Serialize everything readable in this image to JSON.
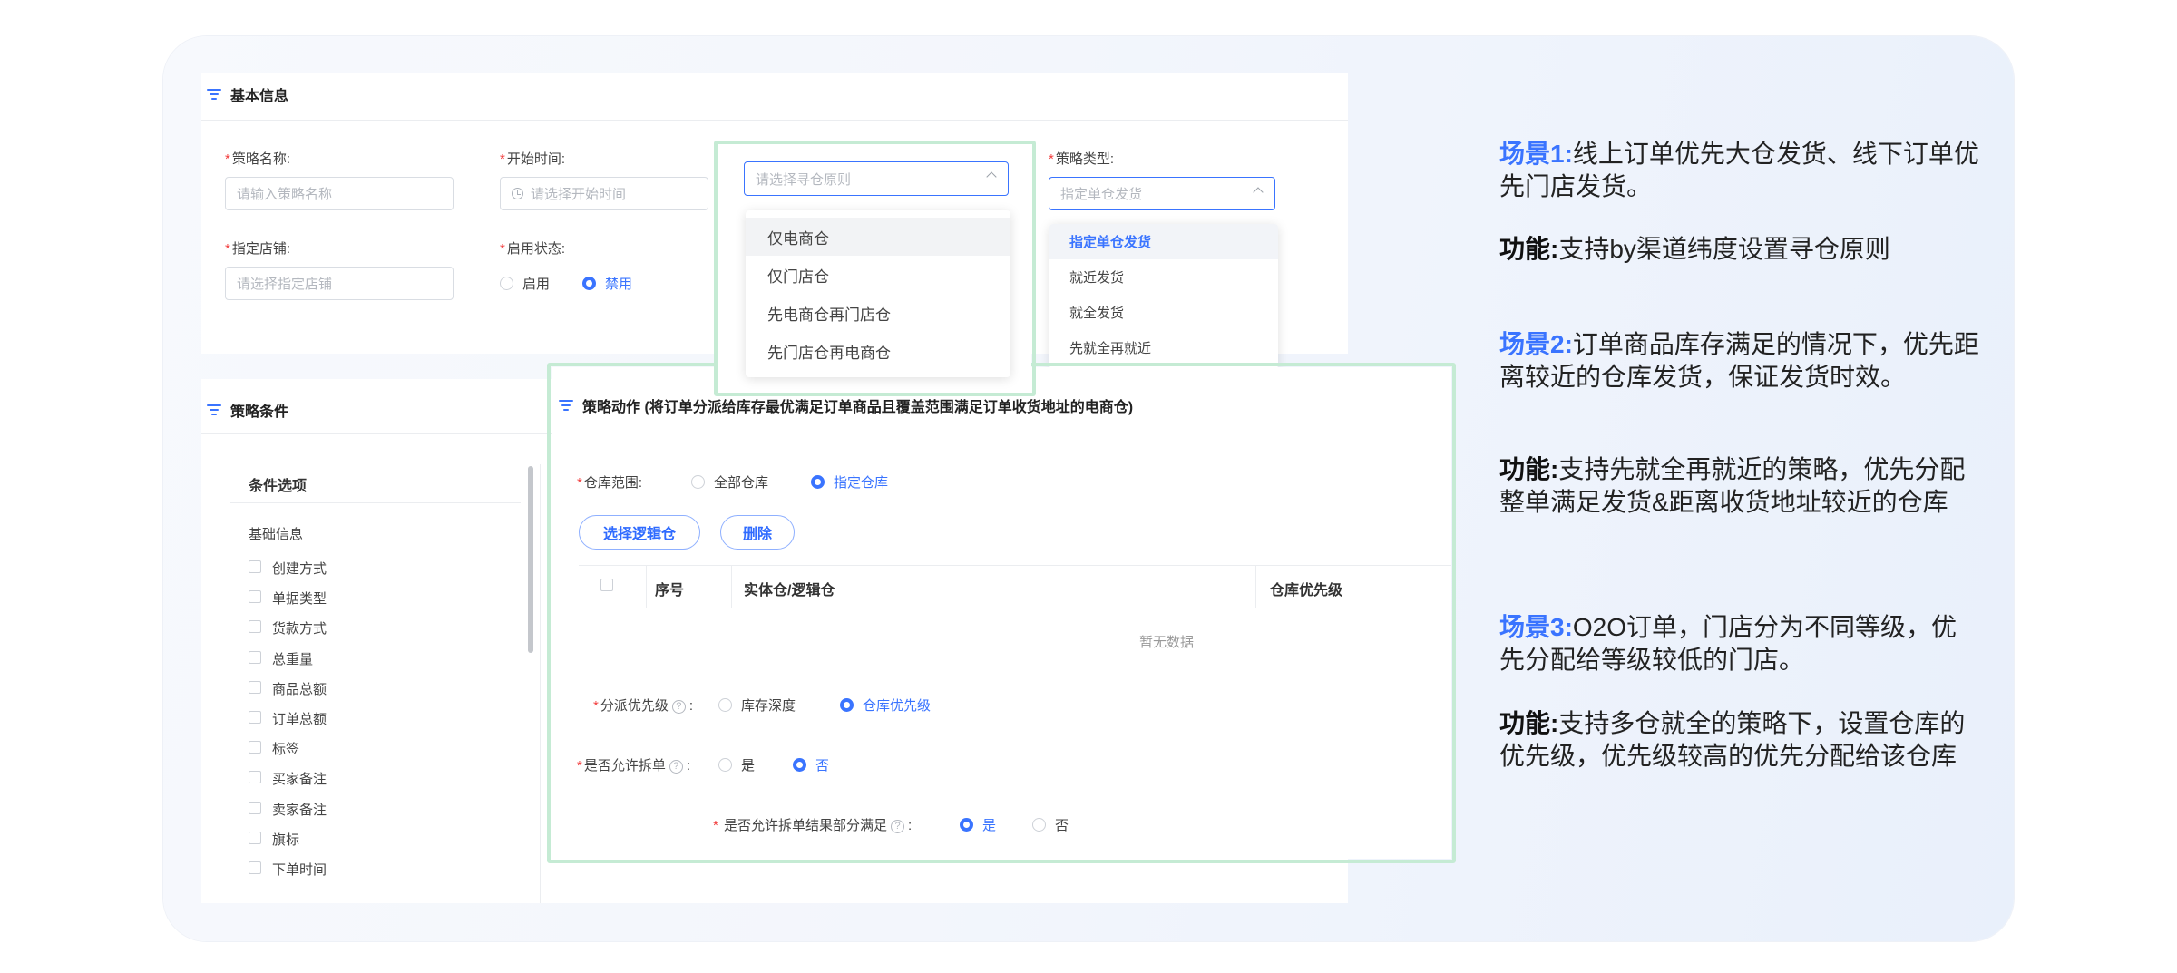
{
  "basic": {
    "title": "基本信息",
    "strategy_name_label": "策略名称:",
    "strategy_name_placeholder": "请输入策略名称",
    "start_time_label": "开始时间:",
    "start_time_placeholder": "请选择开始时间",
    "warehouse_principle_placeholder": "请选择寻仓原则",
    "strategy_type_label": "策略类型:",
    "strategy_type_placeholder": "指定单仓发货",
    "store_label": "指定店铺:",
    "store_placeholder": "请选择指定店铺",
    "status_label": "启用状态:",
    "status_enable": "启用",
    "status_disable": "禁用",
    "principle_options": [
      "仅电商仓",
      "仅门店仓",
      "先电商仓再门店仓",
      "先门店仓再电商仓"
    ],
    "type_options": [
      "指定单仓发货",
      "就近发货",
      "就全发货",
      "先就全再就近"
    ]
  },
  "conditions": {
    "title": "策略条件",
    "header": "条件选项",
    "group": "基础信息",
    "items": [
      "创建方式",
      "单据类型",
      "货款方式",
      "总重量",
      "商品总额",
      "订单总额",
      "标签",
      "买家备注",
      "卖家备注",
      "旗标",
      "下单时间"
    ]
  },
  "action": {
    "title": "策略动作 (将订单分派给库存最优满足订单商品且覆盖范围满足订单收货地址的电商仓)",
    "scope_label": "仓库范围:",
    "scope_all": "全部仓库",
    "scope_specified": "指定仓库",
    "select_btn": "选择逻辑仓",
    "delete_btn": "删除",
    "col_no": "序号",
    "col_wh": "实体仓/逻辑仓",
    "col_priority": "仓库优先级",
    "empty": "暂无数据",
    "priority_label": "分派优先级",
    "priority_depth": "库存深度",
    "priority_wh": "仓库优先级",
    "split_label": "是否允许拆单",
    "yes": "是",
    "no": "否",
    "partial_label": "是否允许拆单结果部分满足"
  },
  "scenarios": [
    {
      "head": "场景1:",
      "text": "线上订单优先大仓发货、线下订单优先门店发货。",
      "fn_head": "功能:",
      "fn": "支持by渠道纬度设置寻仓原则"
    },
    {
      "head": "场景2:",
      "text": "订单商品库存满足的情况下，优先距离较近的仓库发货，保证发货时效。",
      "fn_head": "功能:",
      "fn": "支持先就全再就近的策略，优先分配整单满足发货&距离收货地址较近的仓库"
    },
    {
      "head": "场景3:",
      "text": "O2O订单，门店分为不同等级，优先分配给等级较低的门店。",
      "fn_head": "功能:",
      "fn": "支持多仓就全的策略下，设置仓库的优先级，优先级较高的优先分配给该仓库"
    }
  ],
  "colors": {
    "accent": "#3a74ff",
    "highlight_border": "#c5ebd4",
    "required": "#f23c3c"
  }
}
